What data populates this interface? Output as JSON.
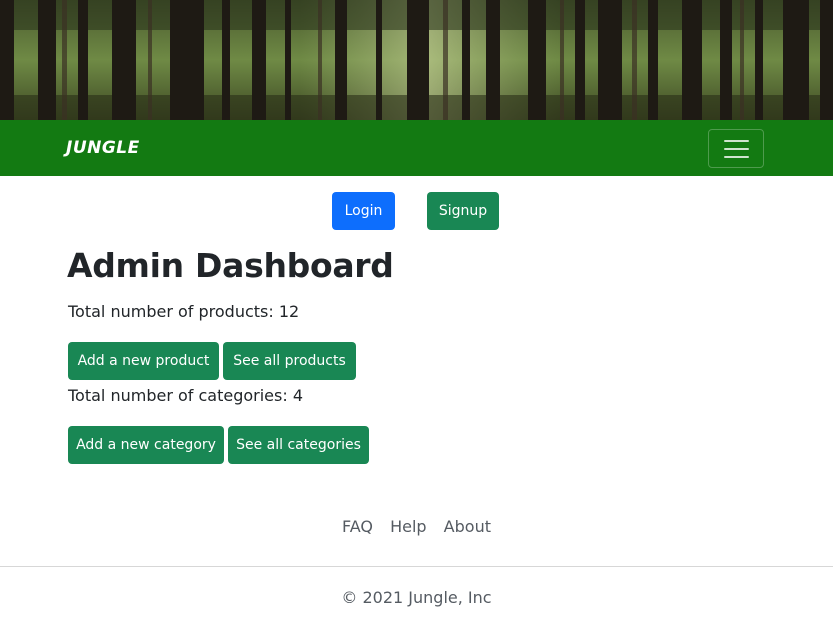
{
  "header": {
    "brand": "JUNGLE",
    "menu_icon": "hamburger-menu-icon"
  },
  "auth": {
    "login_label": "Login",
    "signup_label": "Signup"
  },
  "dashboard": {
    "title": "Admin Dashboard",
    "products_stat": "Total number of products: 12",
    "add_product_label": "Add a new product",
    "see_products_label": "See all products",
    "categories_stat": "Total number of categories: 4",
    "add_category_label": "Add a new category",
    "see_categories_label": "See all categories"
  },
  "footer": {
    "links": [
      "FAQ",
      "Help",
      "About"
    ],
    "copyright": "© 2021 Jungle, Inc"
  },
  "colors": {
    "navbar": "#137a12",
    "login_button": "#0d6efd",
    "green_button": "#198754"
  }
}
